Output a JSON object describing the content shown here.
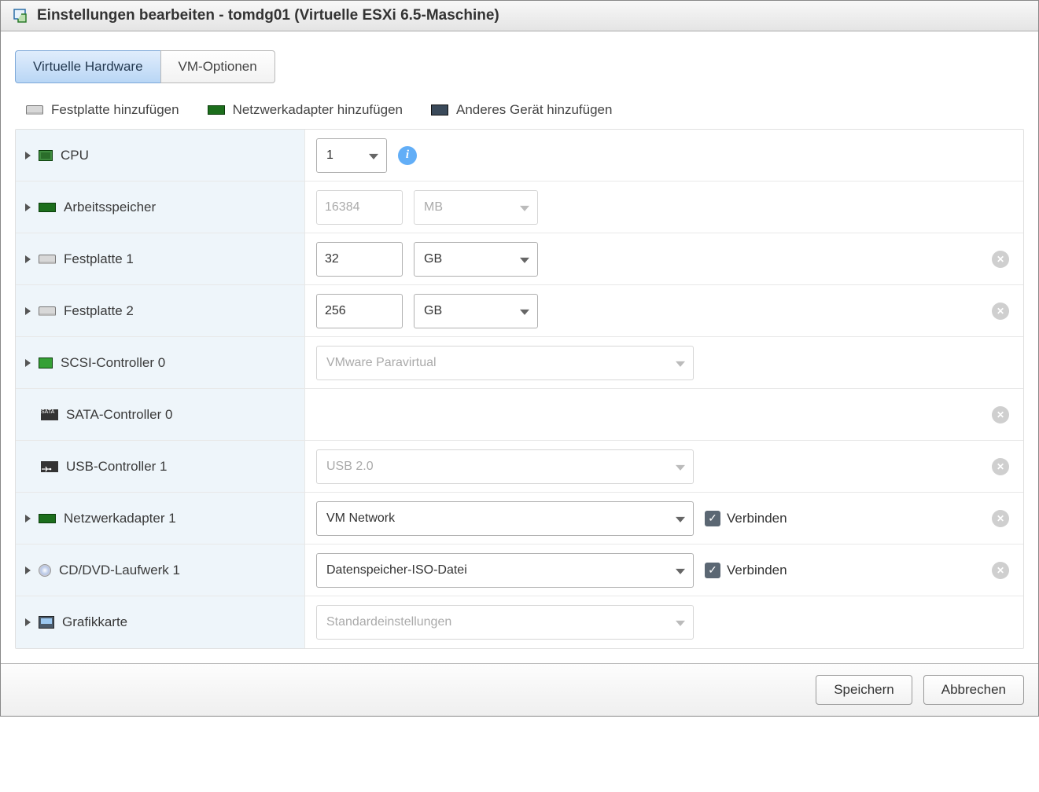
{
  "dialog": {
    "title": "Einstellungen bearbeiten - tomdg01 (Virtuelle ESXi 6.5-Maschine)"
  },
  "tabs": {
    "hardware": "Virtuelle Hardware",
    "options": "VM-Optionen"
  },
  "toolbar": {
    "add_disk": "Festplatte hinzufügen",
    "add_nic": "Netzwerkadapter hinzufügen",
    "add_other": "Anderes Gerät hinzufügen"
  },
  "rows": {
    "cpu": {
      "label": "CPU",
      "value": "1"
    },
    "memory": {
      "label": "Arbeitsspeicher",
      "value": "16384",
      "unit": "MB"
    },
    "disk1": {
      "label": "Festplatte 1",
      "value": "32",
      "unit": "GB"
    },
    "disk2": {
      "label": "Festplatte 2",
      "value": "256",
      "unit": "GB"
    },
    "scsi": {
      "label": "SCSI-Controller 0",
      "value": "VMware Paravirtual"
    },
    "sata": {
      "label": "SATA-Controller 0"
    },
    "usb": {
      "label": "USB-Controller 1",
      "value": "USB 2.0"
    },
    "nic": {
      "label": "Netzwerkadapter 1",
      "value": "VM Network",
      "connect": "Verbinden"
    },
    "cd": {
      "label": "CD/DVD-Laufwerk 1",
      "value": "Datenspeicher-ISO-Datei",
      "connect": "Verbinden"
    },
    "gpu": {
      "label": "Grafikkarte",
      "value": "Standardeinstellungen"
    }
  },
  "footer": {
    "save": "Speichern",
    "cancel": "Abbrechen"
  }
}
